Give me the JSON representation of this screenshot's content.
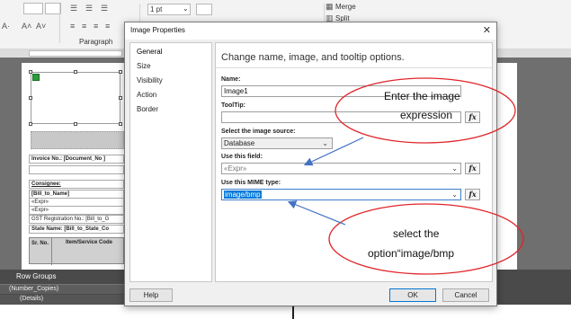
{
  "ribbon": {
    "font_size_value": "1 pt",
    "paragraph_label": "Paragraph",
    "merge_label": "Merge",
    "split_label": "Split"
  },
  "designer": {
    "fields": [
      "Invoice No.: [Document_No ]",
      "Consignee:",
      "[Bill_to_Name]",
      "«Expr»",
      "«Expr»",
      "GST Registration No.: [Bill_to_G",
      "State Name: [Bill_to_State_Co"
    ],
    "table_header_col1": "Sr. No.",
    "table_header_col2": "Item/Service Code"
  },
  "groups_panel": {
    "title": "Row Groups",
    "row1": "(Number_Copies)",
    "row2": "(Details)"
  },
  "dialog": {
    "title": "Image Properties",
    "close_glyph": "✕",
    "nav_items": [
      "General",
      "Size",
      "Visibility",
      "Action",
      "Border"
    ],
    "heading": "Change name, image, and tooltip options.",
    "name_label": "Name:",
    "name_value": "Image1",
    "tooltip_label": "ToolTip:",
    "tooltip_value": "",
    "source_label": "Select the image source:",
    "source_value": "Database",
    "field_label": "Use this field:",
    "field_value": "«Expr»",
    "mime_label": "Use this MIME type:",
    "mime_value": "image/bmp",
    "fx_label": "fx",
    "help_button": "Help",
    "ok_button": "OK",
    "cancel_button": "Cancel"
  },
  "annotations": {
    "callout1_line1": "Enter the image",
    "callout1_line2": "expression",
    "callout2_line1": "select the",
    "callout2_line2": "option“image/bmp",
    "ellipse_color": "#e0262b",
    "arrow_color": "#4472c4"
  }
}
